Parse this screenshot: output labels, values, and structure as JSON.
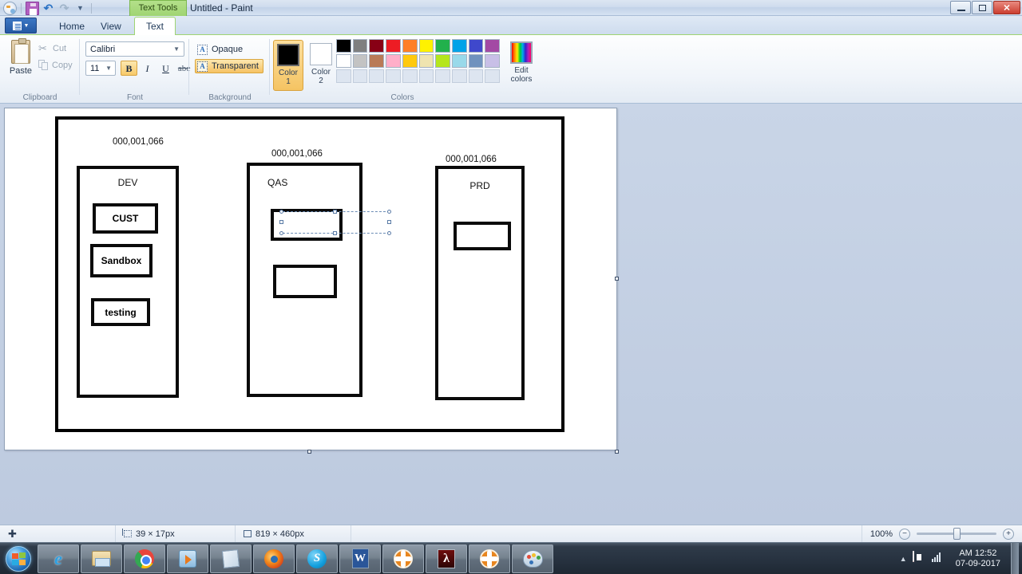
{
  "window": {
    "title": "Untitled - Paint",
    "contextual_tab": "Text Tools",
    "quick_access": [
      "paint-logo",
      "save",
      "undo",
      "redo",
      "customize"
    ],
    "controls": {
      "minimize": "Minimize",
      "maximize": "Maximize",
      "close": "Close"
    }
  },
  "tabs": {
    "file_button": "File",
    "items": [
      {
        "label": "Home",
        "active": false
      },
      {
        "label": "View",
        "active": false
      },
      {
        "label": "Text",
        "active": true
      }
    ]
  },
  "ribbon": {
    "groups": [
      {
        "name": "Clipboard"
      },
      {
        "name": "Font"
      },
      {
        "name": "Background"
      },
      {
        "name": "Colors"
      }
    ],
    "clipboard": {
      "paste": "Paste",
      "cut": "Cut",
      "copy": "Copy"
    },
    "font": {
      "family": "Calibri",
      "size": "11",
      "bold": "B",
      "italic": "I",
      "underline": "U",
      "strikethrough": "abc",
      "bold_active": true
    },
    "background": {
      "opaque": "Opaque",
      "transparent": "Transparent",
      "selected": "Transparent"
    },
    "colors": {
      "color1_label_line1": "Color",
      "color1_label_line2": "1",
      "color2_label_line1": "Color",
      "color2_label_line2": "2",
      "color1_value": "#000000",
      "color2_value": "#ffffff",
      "edit_colors_line1": "Edit",
      "edit_colors_line2": "colors",
      "row1": [
        "#000000",
        "#7f7f7f",
        "#880015",
        "#ed1c24",
        "#ff7f27",
        "#fff200",
        "#22b14c",
        "#00a2e8",
        "#3f48cc",
        "#a349a4"
      ],
      "row2": [
        "#ffffff",
        "#c3c3c3",
        "#b97a57",
        "#ffaec9",
        "#ffc90e",
        "#efe4b0",
        "#b5e61d",
        "#99d9ea",
        "#7092be",
        "#c8bfe7"
      ],
      "row3": [
        "#dde5f0",
        "#dde5f0",
        "#dde5f0",
        "#dde5f0",
        "#dde5f0",
        "#dde5f0",
        "#dde5f0",
        "#dde5f0",
        "#dde5f0",
        "#dde5f0"
      ]
    }
  },
  "canvas": {
    "diagram": {
      "outer_frame": true,
      "ip_labels": [
        {
          "id": "dev",
          "text": "000,001,066"
        },
        {
          "id": "qas",
          "text": "000,001,066"
        },
        {
          "id": "prd",
          "text": "000,001,066"
        }
      ],
      "columns": [
        {
          "id": "dev",
          "title": "DEV",
          "nodes": [
            {
              "id": "cust",
              "label": "CUST"
            },
            {
              "id": "sandbox",
              "label": "Sandbox"
            },
            {
              "id": "testing",
              "label": "testing"
            }
          ]
        },
        {
          "id": "qas",
          "title": "QAS",
          "nodes": [
            {
              "id": "qas1",
              "label": ""
            },
            {
              "id": "qas2",
              "label": ""
            }
          ]
        },
        {
          "id": "prd",
          "title": "PRD",
          "nodes": [
            {
              "id": "prd1",
              "label": ""
            }
          ]
        }
      ],
      "text_selection_active": true
    }
  },
  "statusbar": {
    "cursor_position": "",
    "selection_size": "39 × 17px",
    "image_size": "819 × 460px",
    "zoom_level": "100%",
    "zoom_out": "−",
    "zoom_in": "+"
  },
  "taskbar": {
    "start": "Start",
    "items": [
      {
        "name": "internet-explorer",
        "running": true
      },
      {
        "name": "windows-explorer",
        "running": true
      },
      {
        "name": "google-chrome",
        "running": true
      },
      {
        "name": "windows-media-player",
        "running": true
      },
      {
        "name": "sticky-notes",
        "running": true
      },
      {
        "name": "firefox",
        "running": true
      },
      {
        "name": "skype",
        "running": true
      },
      {
        "name": "microsoft-word",
        "running": true
      },
      {
        "name": "flower-app",
        "running": true
      },
      {
        "name": "adobe-reader",
        "running": true
      },
      {
        "name": "flower-app-2",
        "running": true
      },
      {
        "name": "paint",
        "running": true
      }
    ],
    "tray": {
      "time": "AM 12:52",
      "date": "07-09-2017"
    }
  }
}
